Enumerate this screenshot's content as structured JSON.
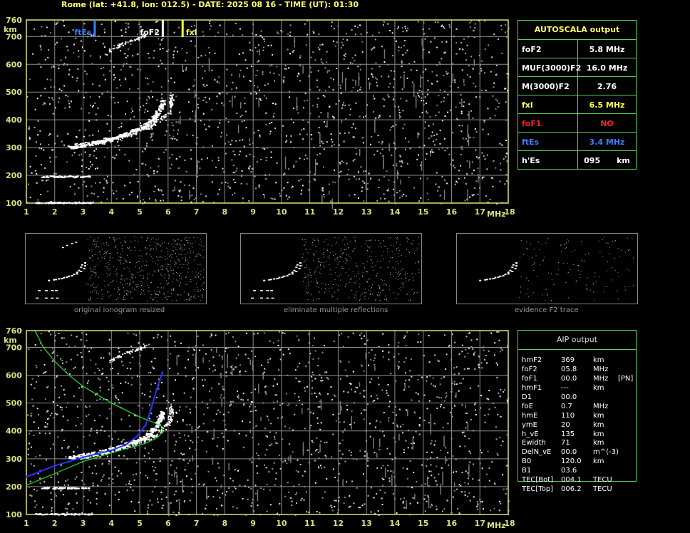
{
  "header": "Rome (lat: +41.8, lon: 012.5) - DATE: 2025 08 16 - TIME (UT): 01:30",
  "colors": {
    "axis": "#d8e27a",
    "grid": "#8a8a8a",
    "table_border": "#55d15a",
    "ftes": "#3f7fff",
    "fof2": "#ffffff",
    "fxl": "#ffff44",
    "fof1": "#ff2020",
    "title": "#ffff66",
    "profile_green": "#22dd22",
    "profile_blue": "#2233ff"
  },
  "chart_data": [
    {
      "type": "scatter",
      "name": "top_ionogram",
      "xlabel": "MHz",
      "ylabel": "km",
      "xlim": [
        1,
        18
      ],
      "ylim": [
        100,
        760
      ],
      "x_ticks": [
        "1",
        "2",
        "3",
        "4",
        "5",
        "6",
        "7",
        "8",
        "9",
        "10",
        "11",
        "12",
        "13",
        "14",
        "15",
        "16",
        "17",
        "18"
      ],
      "y_ticks": [
        "100",
        "200",
        "300",
        "400",
        "500",
        "600",
        "700",
        "760"
      ],
      "grid": true,
      "markers": [
        {
          "label": "ftEs",
          "x": 3.4,
          "color": "#3f7fff"
        },
        {
          "label": "foF2",
          "x": 5.8,
          "color": "#ffffff"
        },
        {
          "label": "fxl",
          "x": 6.5,
          "color": "#ffff44"
        }
      ],
      "traces": {
        "o_trace": [
          [
            2.5,
            305
          ],
          [
            3.0,
            312
          ],
          [
            3.5,
            322
          ],
          [
            4.0,
            335
          ],
          [
            4.5,
            350
          ],
          [
            5.0,
            370
          ],
          [
            5.3,
            390
          ],
          [
            5.5,
            410
          ],
          [
            5.7,
            445
          ],
          [
            5.8,
            470
          ]
        ],
        "x_trace": [
          [
            3.2,
            315
          ],
          [
            3.8,
            325
          ],
          [
            4.3,
            340
          ],
          [
            4.8,
            355
          ],
          [
            5.3,
            375
          ],
          [
            5.7,
            400
          ],
          [
            6.0,
            430
          ],
          [
            6.1,
            460
          ],
          [
            6.1,
            490
          ]
        ],
        "es_trace": [
          [
            1.5,
            197
          ],
          [
            3.2,
            197
          ]
        ],
        "e_trace": [
          [
            1.3,
            103
          ],
          [
            3.3,
            103
          ]
        ],
        "multiple": [
          [
            3.9,
            650
          ],
          [
            4.3,
            672
          ],
          [
            4.8,
            692
          ],
          [
            5.2,
            705
          ]
        ]
      }
    },
    {
      "type": "line",
      "name": "bottom_profile",
      "xlabel": "MHz",
      "ylabel": "km",
      "xlim": [
        1,
        18
      ],
      "ylim": [
        100,
        760
      ],
      "x_ticks": [
        "1",
        "2",
        "3",
        "4",
        "5",
        "6",
        "7",
        "8",
        "9",
        "10",
        "11",
        "12",
        "13",
        "14",
        "15",
        "16",
        "17",
        "18"
      ],
      "y_ticks": [
        "100",
        "200",
        "300",
        "400",
        "500",
        "600",
        "700",
        "760"
      ],
      "grid": true,
      "series": [
        {
          "color": "#22dd22",
          "points": [
            [
              1.3,
              760
            ],
            [
              1.6,
              700
            ],
            [
              2.0,
              650
            ],
            [
              2.5,
              600
            ],
            [
              3.0,
              560
            ],
            [
              3.5,
              530
            ],
            [
              4.0,
              500
            ],
            [
              4.5,
              475
            ],
            [
              5.0,
              450
            ],
            [
              5.5,
              430
            ],
            [
              5.8,
              415
            ],
            [
              5.8,
              395
            ],
            [
              5.6,
              375
            ],
            [
              5.2,
              355
            ],
            [
              4.5,
              335
            ],
            [
              3.8,
              315
            ],
            [
              3.0,
              290
            ],
            [
              2.3,
              260
            ],
            [
              1.6,
              230
            ],
            [
              1.0,
              205
            ]
          ]
        },
        {
          "color": "#2233ff",
          "points": [
            [
              1.0,
              235
            ],
            [
              1.5,
              255
            ],
            [
              2.0,
              275
            ],
            [
              2.5,
              290
            ],
            [
              3.0,
              305
            ],
            [
              3.5,
              318
            ],
            [
              4.0,
              330
            ],
            [
              4.5,
              350
            ],
            [
              4.9,
              380
            ],
            [
              5.2,
              420
            ],
            [
              5.4,
              480
            ],
            [
              5.6,
              550
            ],
            [
              5.8,
              610
            ]
          ]
        }
      ]
    }
  ],
  "autoscala": {
    "title": "AUTOSCALA output",
    "rows": [
      {
        "label": "foF2",
        "value": "5.8 MHz",
        "color": "#ffffff"
      },
      {
        "label": "MUF(3000)F2",
        "value": "16.0 MHz",
        "color": "#ffffff"
      },
      {
        "label": "M(3000)F2",
        "value": "2.76",
        "color": "#ffffff"
      },
      {
        "label": "fxl",
        "value": "6.5 MHz",
        "color": "#ffff44"
      },
      {
        "label": "foF1",
        "value": "NO",
        "color": "#ff2020"
      },
      {
        "label": "ftEs",
        "value": "3.4 MHz",
        "color": "#3f7fff"
      },
      {
        "label": "h'Es",
        "value": "095      km",
        "color": "#ffffff"
      }
    ]
  },
  "thumbnails": [
    {
      "caption": "original ionogram resized"
    },
    {
      "caption": "eliminate multiple reflections"
    },
    {
      "caption": "evidence F2 trace"
    }
  ],
  "aip": {
    "title": "AIP output",
    "rows": [
      {
        "name": "hmF2",
        "value": "369",
        "unit": "km",
        "extra": ""
      },
      {
        "name": "foF2",
        "value": "05.8",
        "unit": "MHz",
        "extra": ""
      },
      {
        "name": "foF1",
        "value": "00.0",
        "unit": "MHz",
        "extra": "[PN]"
      },
      {
        "name": "hmF1",
        "value": "---",
        "unit": "km",
        "extra": ""
      },
      {
        "name": "D1",
        "value": "00.0",
        "unit": "",
        "extra": ""
      },
      {
        "name": "foE",
        "value": "0.7",
        "unit": "MHz",
        "extra": ""
      },
      {
        "name": "hmE",
        "value": "110",
        "unit": "km",
        "extra": ""
      },
      {
        "name": "ymE",
        "value": "20",
        "unit": "km",
        "extra": ""
      },
      {
        "name": "h_vE",
        "value": "135",
        "unit": "km",
        "extra": ""
      },
      {
        "name": "Ewidth",
        "value": "71",
        "unit": "km",
        "extra": ""
      },
      {
        "name": "DelN_vE",
        "value": "00.0",
        "unit": "m^(-3)",
        "extra": ""
      },
      {
        "name": "B0",
        "value": "120.0",
        "unit": "km",
        "extra": ""
      },
      {
        "name": "B1",
        "value": "03.6",
        "unit": "",
        "extra": ""
      },
      {
        "name": "TEC[Bot]",
        "value": "004.1",
        "unit": "TECU",
        "extra": ""
      },
      {
        "name": "TEC[Top]",
        "value": "006.2",
        "unit": "TECU",
        "extra": ""
      }
    ]
  }
}
